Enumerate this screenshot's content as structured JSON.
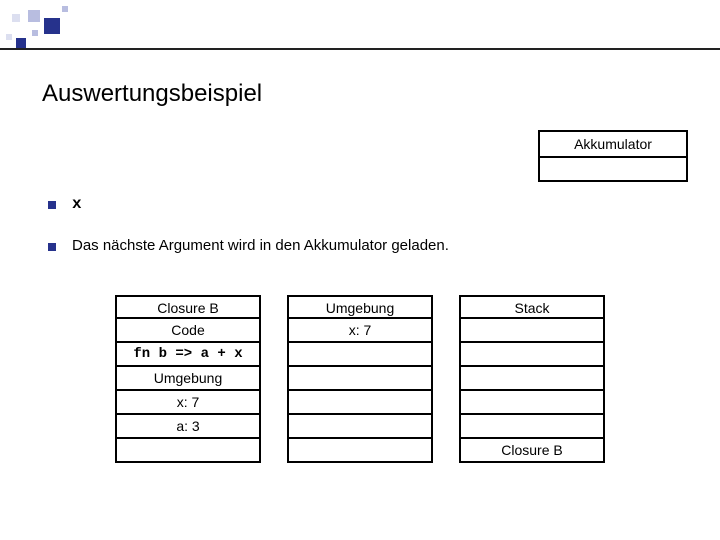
{
  "title": "Auswertungsbeispiel",
  "akkumulator": {
    "label": "Akkumulator",
    "value": ""
  },
  "bullets": {
    "code": "x",
    "note": "Das nächste Argument wird in den Akkumulator geladen."
  },
  "closure_col": {
    "r0": "Closure B",
    "r1": "Code",
    "r2": "fn b => a + x",
    "r3": "Umgebung",
    "r4": "x: 7",
    "r5": "a: 3",
    "r6": ""
  },
  "umgebung_col": {
    "r0": "Umgebung",
    "r1": "x: 7",
    "r2": "",
    "r3": "",
    "r4": "",
    "r5": "",
    "r6": ""
  },
  "stack_col": {
    "r0": "Stack",
    "r1": "",
    "r2": "",
    "r3": "",
    "r4": "",
    "r5": "",
    "r6": "Closure B"
  }
}
